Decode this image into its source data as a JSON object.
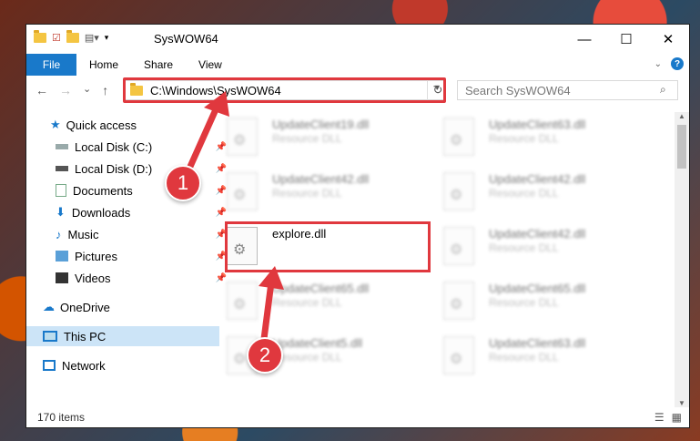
{
  "window": {
    "title": "SysWOW64",
    "controls": {
      "minimize": "—",
      "maximize": "☐",
      "close": "✕"
    }
  },
  "ribbon": {
    "tabs": [
      "File",
      "Home",
      "Share",
      "View"
    ],
    "help_label": "?"
  },
  "nav": {
    "back": "←",
    "forward": "→",
    "recent": "⌄",
    "up": "↑",
    "address": "C:\\Windows\\SysWOW64",
    "refresh": "↻",
    "search_placeholder": "Search SysWOW64",
    "search_icon": "search-icon"
  },
  "sidebar": {
    "items": [
      {
        "label": "Quick access",
        "icon": "star-icon"
      },
      {
        "label": "Local Disk (C:)",
        "icon": "drive-icon"
      },
      {
        "label": "Local Disk (D:)",
        "icon": "drive-icon"
      },
      {
        "label": "Documents",
        "icon": "documents-icon"
      },
      {
        "label": "Downloads",
        "icon": "download-icon"
      },
      {
        "label": "Music",
        "icon": "music-icon"
      },
      {
        "label": "Pictures",
        "icon": "pictures-icon"
      },
      {
        "label": "Videos",
        "icon": "videos-icon"
      },
      {
        "label": "OneDrive",
        "icon": "cloud-icon"
      },
      {
        "label": "This PC",
        "icon": "pc-icon",
        "selected": true
      },
      {
        "label": "Network",
        "icon": "network-icon"
      }
    ]
  },
  "files": [
    {
      "name": "UpdateClient19.dll",
      "type": "Resource DLL"
    },
    {
      "name": "UpdateClient63.dll",
      "type": "Resource DLL"
    },
    {
      "name": "UpdateClient42.dll",
      "type": "Resource DLL"
    },
    {
      "name": "UpdateClient42.dll",
      "type": "Resource DLL"
    },
    {
      "name": "explore.dll",
      "type": ""
    },
    {
      "name": "UpdateClient42.dll",
      "type": "Resource DLL"
    },
    {
      "name": "UpdateClient65.dll",
      "type": "Resource DLL"
    },
    {
      "name": "UpdateClient65.dll",
      "type": "Resource DLL"
    },
    {
      "name": "UpdateClient5.dll",
      "type": "Resource DLL"
    },
    {
      "name": "UpdateClient63.dll",
      "type": "Resource DLL"
    }
  ],
  "status": {
    "item_count": "170 items"
  },
  "annotations": {
    "step1": "1",
    "step2": "2",
    "color": "#e0383e"
  }
}
